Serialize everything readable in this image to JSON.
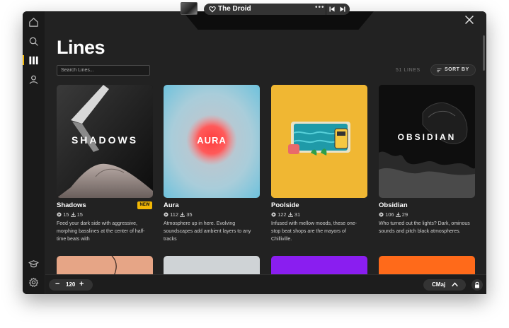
{
  "nav": {
    "items": [
      {
        "name": "home",
        "icon": "home-icon"
      },
      {
        "name": "search",
        "icon": "search-icon"
      },
      {
        "name": "library",
        "icon": "library-icon",
        "active": true
      },
      {
        "name": "profile",
        "icon": "user-icon"
      }
    ],
    "bottom": [
      {
        "name": "learn",
        "icon": "graduation-cap-icon"
      },
      {
        "name": "settings",
        "icon": "gear-icon"
      }
    ]
  },
  "player": {
    "title": "The Droid",
    "more_label": "•••"
  },
  "page": {
    "title": "Lines",
    "search_placeholder": "Search Lines...",
    "count_label": "51 LINES",
    "sort_label": "SORT BY"
  },
  "cards": [
    {
      "name": "Shadows",
      "art_text": "SHADOWS",
      "plays": "15",
      "downloads": "15",
      "badge": "NEW",
      "description": "Feed your dark side with aggressive, morphing basslines at the center of half-time beats with"
    },
    {
      "name": "Aura",
      "art_text": "AURA",
      "plays": "112",
      "downloads": "35",
      "description": "Atmosphere up in here. Evolving soundscapes add ambient layers to any tracks"
    },
    {
      "name": "Poolside",
      "plays": "122",
      "downloads": "31",
      "description": "Infused with mellow moods, these one-stop beat shops are the mayors of Chilliville."
    },
    {
      "name": "Obsidian",
      "art_text": "OBSIDIAN",
      "plays": "106",
      "downloads": "29",
      "description": "Who turned out the lights? Dark, ominous sounds and pitch black atmospheres."
    }
  ],
  "footer": {
    "tempo_minus": "−",
    "tempo": "120",
    "tempo_plus": "+",
    "key": "CMaj"
  },
  "colors": {
    "accent": "#f2b705",
    "background": "#222222",
    "sidebar": "#1a1a1a"
  }
}
